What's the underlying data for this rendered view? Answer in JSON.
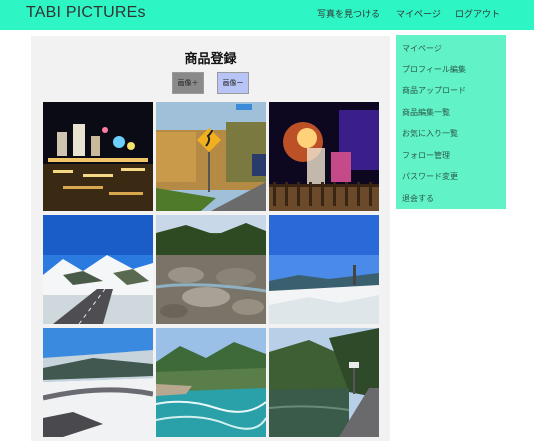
{
  "header": {
    "brand": "TABI PICTUREs",
    "nav": [
      "写真を見つける",
      "マイページ",
      "ログアウト"
    ]
  },
  "main": {
    "title": "商品登録",
    "add_button": "画像＋",
    "remove_button": "画像ー",
    "photos": [
      "night-illuminated-garden",
      "autumn-road-curve-sign",
      "night-waterfall-light-show",
      "snowy-mountain-road",
      "rocky-river-bed",
      "snowy-mountain-slope",
      "snowy-valley-road",
      "river-valley-mountains",
      "lake-mountain-road"
    ]
  },
  "sidebar": {
    "items": [
      "マイページ",
      "プロフィール編集",
      "商品アップロード",
      "商品編集一覧",
      "お気に入り一覧",
      "フォロー管理",
      "パスワード変更",
      "退会する"
    ]
  },
  "colors": {
    "header": "#2ef5c4",
    "sidebar": "#62f2c8",
    "main_panel": "#f2f2f2"
  }
}
